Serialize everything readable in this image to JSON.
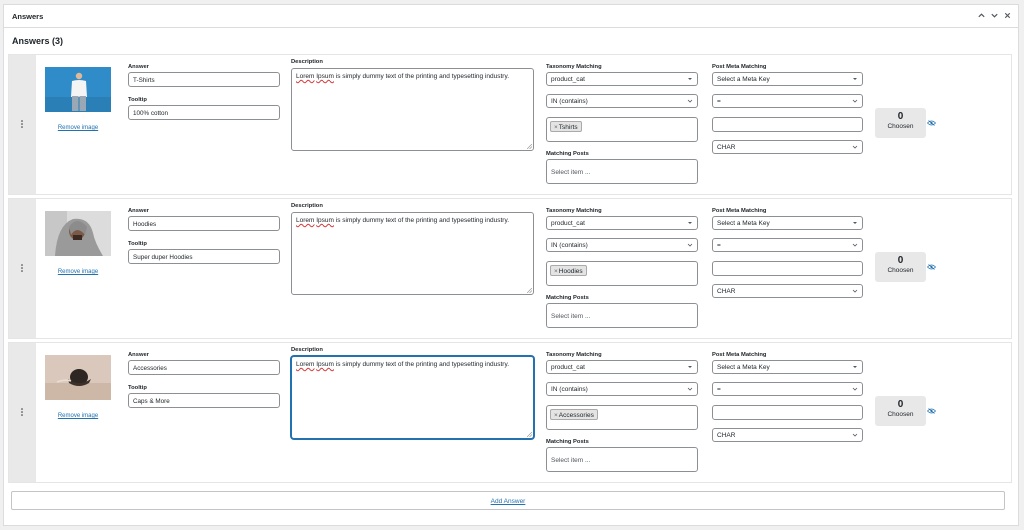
{
  "panel": {
    "title": "Answers"
  },
  "answers_heading": "Answers (3)",
  "labels": {
    "answer": "Answer",
    "tooltip": "Tooltip",
    "description": "Description",
    "taxonomy": "Taxonomy Matching",
    "matching_posts": "Matching Posts",
    "post_meta": "Post Meta Matching",
    "remove_image": "Remove image",
    "chosen": "Choosen"
  },
  "answers": [
    {
      "answer": "T-Shirts",
      "tooltip": "100% cotton",
      "desc_w1": "Lorem",
      "desc_w2": "Ipsum",
      "desc_rest": " is simply dummy text of the printing and typesetting industry.",
      "taxonomy": "product_cat",
      "operator": "IN (contains)",
      "term": "Tshirts",
      "posts_placeholder": "Select item ...",
      "meta_key": "Select a Meta Key",
      "compare": "=",
      "meta_value": "",
      "meta_type": "CHAR",
      "chosen_count": "0"
    },
    {
      "answer": "Hoodies",
      "tooltip": "Super duper Hoodies",
      "desc_w1": "Lorem",
      "desc_w2": "Ipsum",
      "desc_rest": " is simply dummy text of the printing and typesetting industry.",
      "taxonomy": "product_cat",
      "operator": "IN (contains)",
      "term": "Hoodies",
      "posts_placeholder": "Select item ...",
      "meta_key": "Select a Meta Key",
      "compare": "=",
      "meta_value": "",
      "meta_type": "CHAR",
      "chosen_count": "0"
    },
    {
      "answer": "Accessories",
      "tooltip": "Caps & More",
      "desc_w1": "Lorem",
      "desc_w2": "Ipsum",
      "desc_rest": " is simply dummy text of the printing and typesetting industry.",
      "taxonomy": "product_cat",
      "operator": "IN (contains)",
      "term": "Accessories",
      "posts_placeholder": "Select item ...",
      "meta_key": "Select a Meta Key",
      "compare": "=",
      "meta_value": "",
      "meta_type": "CHAR",
      "chosen_count": "0"
    }
  ],
  "add_answer": "Add Answer",
  "icons": {
    "collapse": "chevron-up-icon",
    "expand": "chevron-down-icon",
    "close": "close-icon",
    "drag": "drag-handle-icon",
    "visibility": "eye-slash-icon"
  },
  "colors": {
    "link": "#2271b1",
    "focus": "#2271b1",
    "border": "#8c8f94"
  }
}
